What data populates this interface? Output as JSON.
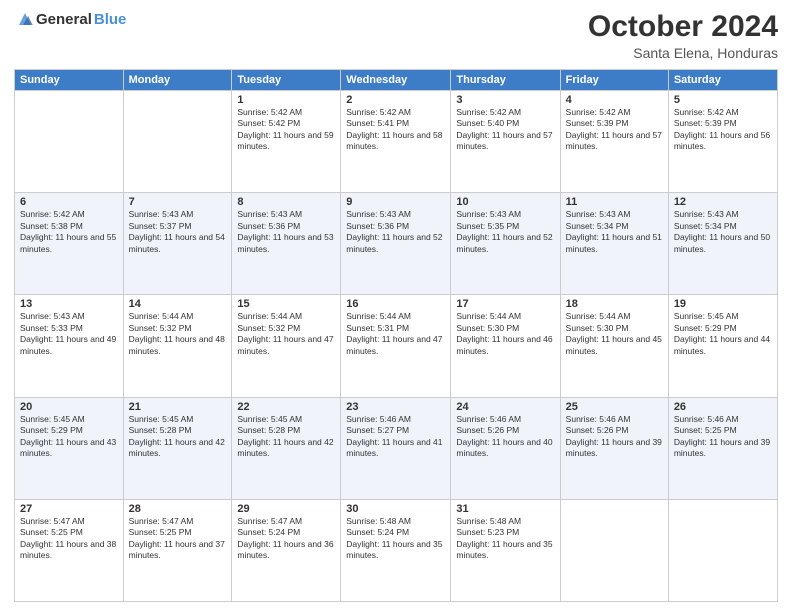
{
  "header": {
    "logo": {
      "text_general": "General",
      "text_blue": "Blue"
    },
    "month": "October 2024",
    "location": "Santa Elena, Honduras"
  },
  "weekdays": [
    "Sunday",
    "Monday",
    "Tuesday",
    "Wednesday",
    "Thursday",
    "Friday",
    "Saturday"
  ],
  "weeks": [
    [
      {
        "day": "",
        "sunrise": "",
        "sunset": "",
        "daylight": ""
      },
      {
        "day": "",
        "sunrise": "",
        "sunset": "",
        "daylight": ""
      },
      {
        "day": "1",
        "sunrise": "Sunrise: 5:42 AM",
        "sunset": "Sunset: 5:42 PM",
        "daylight": "Daylight: 11 hours and 59 minutes."
      },
      {
        "day": "2",
        "sunrise": "Sunrise: 5:42 AM",
        "sunset": "Sunset: 5:41 PM",
        "daylight": "Daylight: 11 hours and 58 minutes."
      },
      {
        "day": "3",
        "sunrise": "Sunrise: 5:42 AM",
        "sunset": "Sunset: 5:40 PM",
        "daylight": "Daylight: 11 hours and 57 minutes."
      },
      {
        "day": "4",
        "sunrise": "Sunrise: 5:42 AM",
        "sunset": "Sunset: 5:39 PM",
        "daylight": "Daylight: 11 hours and 57 minutes."
      },
      {
        "day": "5",
        "sunrise": "Sunrise: 5:42 AM",
        "sunset": "Sunset: 5:39 PM",
        "daylight": "Daylight: 11 hours and 56 minutes."
      }
    ],
    [
      {
        "day": "6",
        "sunrise": "Sunrise: 5:42 AM",
        "sunset": "Sunset: 5:38 PM",
        "daylight": "Daylight: 11 hours and 55 minutes."
      },
      {
        "day": "7",
        "sunrise": "Sunrise: 5:43 AM",
        "sunset": "Sunset: 5:37 PM",
        "daylight": "Daylight: 11 hours and 54 minutes."
      },
      {
        "day": "8",
        "sunrise": "Sunrise: 5:43 AM",
        "sunset": "Sunset: 5:36 PM",
        "daylight": "Daylight: 11 hours and 53 minutes."
      },
      {
        "day": "9",
        "sunrise": "Sunrise: 5:43 AM",
        "sunset": "Sunset: 5:36 PM",
        "daylight": "Daylight: 11 hours and 52 minutes."
      },
      {
        "day": "10",
        "sunrise": "Sunrise: 5:43 AM",
        "sunset": "Sunset: 5:35 PM",
        "daylight": "Daylight: 11 hours and 52 minutes."
      },
      {
        "day": "11",
        "sunrise": "Sunrise: 5:43 AM",
        "sunset": "Sunset: 5:34 PM",
        "daylight": "Daylight: 11 hours and 51 minutes."
      },
      {
        "day": "12",
        "sunrise": "Sunrise: 5:43 AM",
        "sunset": "Sunset: 5:34 PM",
        "daylight": "Daylight: 11 hours and 50 minutes."
      }
    ],
    [
      {
        "day": "13",
        "sunrise": "Sunrise: 5:43 AM",
        "sunset": "Sunset: 5:33 PM",
        "daylight": "Daylight: 11 hours and 49 minutes."
      },
      {
        "day": "14",
        "sunrise": "Sunrise: 5:44 AM",
        "sunset": "Sunset: 5:32 PM",
        "daylight": "Daylight: 11 hours and 48 minutes."
      },
      {
        "day": "15",
        "sunrise": "Sunrise: 5:44 AM",
        "sunset": "Sunset: 5:32 PM",
        "daylight": "Daylight: 11 hours and 47 minutes."
      },
      {
        "day": "16",
        "sunrise": "Sunrise: 5:44 AM",
        "sunset": "Sunset: 5:31 PM",
        "daylight": "Daylight: 11 hours and 47 minutes."
      },
      {
        "day": "17",
        "sunrise": "Sunrise: 5:44 AM",
        "sunset": "Sunset: 5:30 PM",
        "daylight": "Daylight: 11 hours and 46 minutes."
      },
      {
        "day": "18",
        "sunrise": "Sunrise: 5:44 AM",
        "sunset": "Sunset: 5:30 PM",
        "daylight": "Daylight: 11 hours and 45 minutes."
      },
      {
        "day": "19",
        "sunrise": "Sunrise: 5:45 AM",
        "sunset": "Sunset: 5:29 PM",
        "daylight": "Daylight: 11 hours and 44 minutes."
      }
    ],
    [
      {
        "day": "20",
        "sunrise": "Sunrise: 5:45 AM",
        "sunset": "Sunset: 5:29 PM",
        "daylight": "Daylight: 11 hours and 43 minutes."
      },
      {
        "day": "21",
        "sunrise": "Sunrise: 5:45 AM",
        "sunset": "Sunset: 5:28 PM",
        "daylight": "Daylight: 11 hours and 42 minutes."
      },
      {
        "day": "22",
        "sunrise": "Sunrise: 5:45 AM",
        "sunset": "Sunset: 5:28 PM",
        "daylight": "Daylight: 11 hours and 42 minutes."
      },
      {
        "day": "23",
        "sunrise": "Sunrise: 5:46 AM",
        "sunset": "Sunset: 5:27 PM",
        "daylight": "Daylight: 11 hours and 41 minutes."
      },
      {
        "day": "24",
        "sunrise": "Sunrise: 5:46 AM",
        "sunset": "Sunset: 5:26 PM",
        "daylight": "Daylight: 11 hours and 40 minutes."
      },
      {
        "day": "25",
        "sunrise": "Sunrise: 5:46 AM",
        "sunset": "Sunset: 5:26 PM",
        "daylight": "Daylight: 11 hours and 39 minutes."
      },
      {
        "day": "26",
        "sunrise": "Sunrise: 5:46 AM",
        "sunset": "Sunset: 5:25 PM",
        "daylight": "Daylight: 11 hours and 39 minutes."
      }
    ],
    [
      {
        "day": "27",
        "sunrise": "Sunrise: 5:47 AM",
        "sunset": "Sunset: 5:25 PM",
        "daylight": "Daylight: 11 hours and 38 minutes."
      },
      {
        "day": "28",
        "sunrise": "Sunrise: 5:47 AM",
        "sunset": "Sunset: 5:25 PM",
        "daylight": "Daylight: 11 hours and 37 minutes."
      },
      {
        "day": "29",
        "sunrise": "Sunrise: 5:47 AM",
        "sunset": "Sunset: 5:24 PM",
        "daylight": "Daylight: 11 hours and 36 minutes."
      },
      {
        "day": "30",
        "sunrise": "Sunrise: 5:48 AM",
        "sunset": "Sunset: 5:24 PM",
        "daylight": "Daylight: 11 hours and 35 minutes."
      },
      {
        "day": "31",
        "sunrise": "Sunrise: 5:48 AM",
        "sunset": "Sunset: 5:23 PM",
        "daylight": "Daylight: 11 hours and 35 minutes."
      },
      {
        "day": "",
        "sunrise": "",
        "sunset": "",
        "daylight": ""
      },
      {
        "day": "",
        "sunrise": "",
        "sunset": "",
        "daylight": ""
      }
    ]
  ]
}
